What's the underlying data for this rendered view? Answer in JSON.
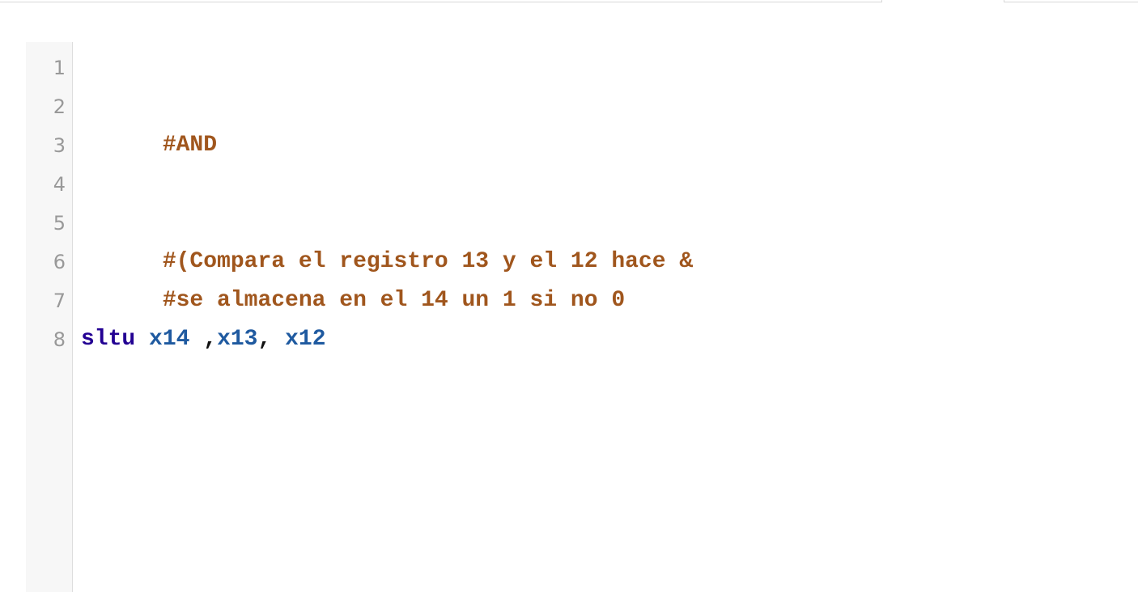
{
  "editor": {
    "line_numbers": [
      "1",
      "2",
      "3",
      "4",
      "5",
      "6",
      "7",
      "8"
    ],
    "lines": [
      {
        "text": ""
      },
      {
        "text": "#AND"
      },
      {
        "text": ""
      },
      {
        "text": ""
      },
      {
        "text": "#(Compara el registro 13 y el 12 hace &"
      },
      {
        "text": "#se almacena en el 14 un 1 si no 0"
      },
      {
        "text": ""
      },
      {
        "tokens": {
          "instr": "sltu",
          "sp1": " ",
          "reg1": "x14",
          "sep1": " ,",
          "reg2": "x13",
          "sep2": ", ",
          "reg3": "x12"
        }
      }
    ]
  },
  "colors": {
    "comment": "#a0561d",
    "keyword": "#230093",
    "register": "#1f5aa0",
    "gutter_bg": "#f7f7f7",
    "line_number": "#999999"
  }
}
